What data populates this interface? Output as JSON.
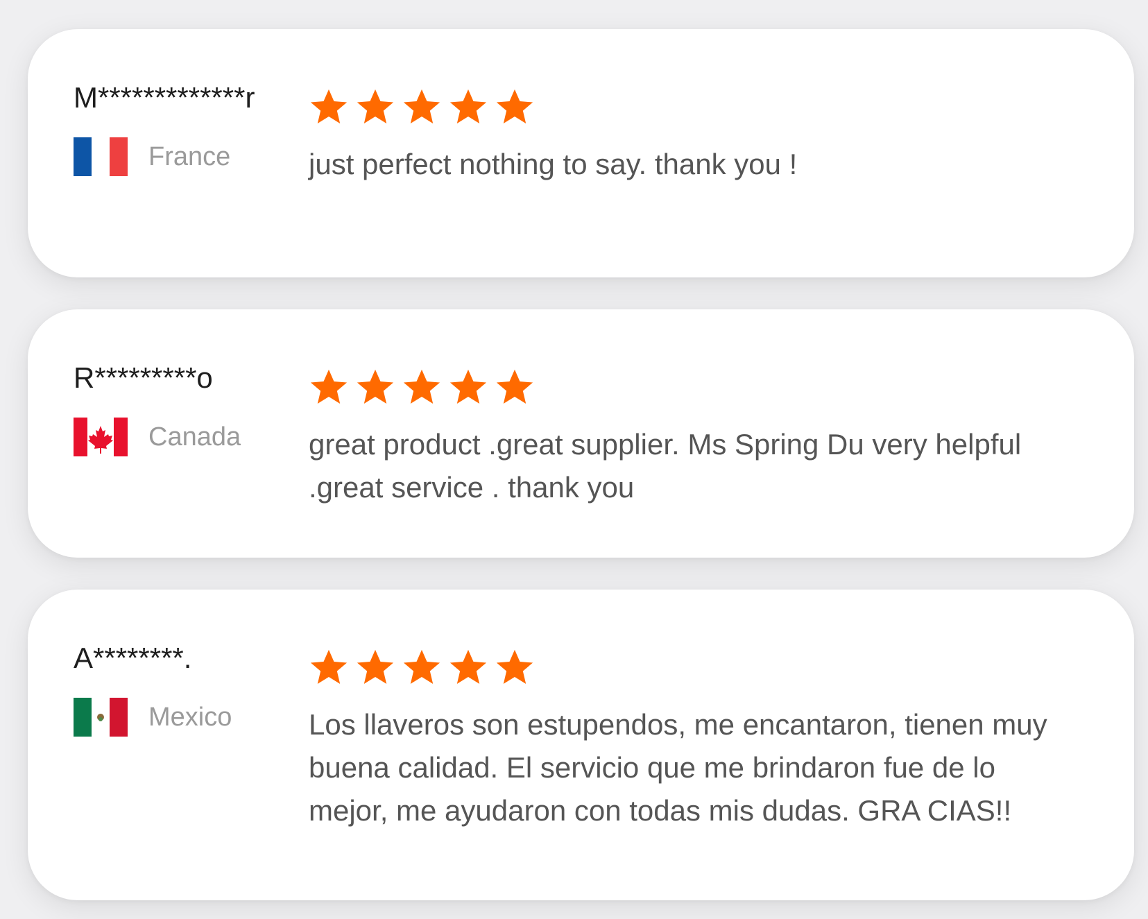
{
  "colors": {
    "star": "#ff6a00",
    "card_bg": "#ffffff",
    "page_bg": "#efeff1",
    "name_text": "#1e1e1e",
    "country_text": "#9a9a9a",
    "review_text": "#555555"
  },
  "reviews": [
    {
      "reviewer": "M*************r",
      "country": "France",
      "flag_icon": "france-flag-icon",
      "rating": 5,
      "text": "just perfect nothing to say.  thank you !"
    },
    {
      "reviewer": "R*********o",
      "country": "Canada",
      "flag_icon": "canada-flag-icon",
      "rating": 5,
      "text": "great product .great supplier. Ms Spring Du very helpful .great service . thank you"
    },
    {
      "reviewer": "A********.",
      "country": "Mexico",
      "flag_icon": "mexico-flag-icon",
      "rating": 5,
      "text": "Los llaveros son estupendos, me encantaron, tienen muy buena calidad. El servicio que me  brindaron fue de lo mejor, me ayudaron con todas mis dudas. GRA CIAS!!"
    }
  ]
}
